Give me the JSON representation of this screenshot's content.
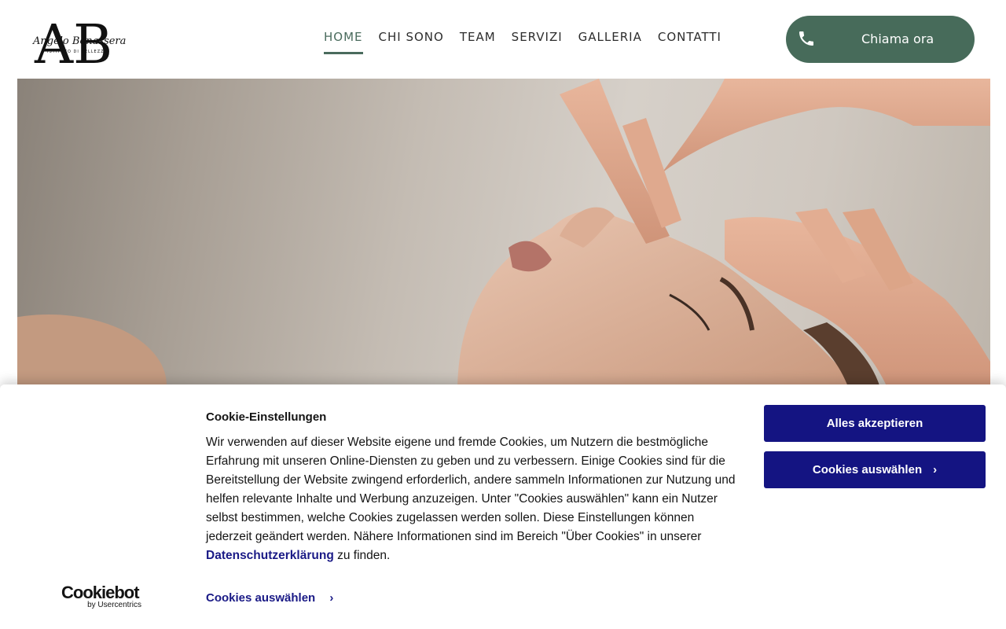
{
  "header": {
    "logo_text": "Angelo Bonassera",
    "logo_subtext": "ISTITUTO DI BELLEZZA",
    "logo_initials": "AB",
    "nav": [
      {
        "label": "HOME",
        "active": true
      },
      {
        "label": "CHI SONO",
        "active": false
      },
      {
        "label": "TEAM",
        "active": false
      },
      {
        "label": "SERVIZI",
        "active": false
      },
      {
        "label": "GALLERIA",
        "active": false
      },
      {
        "label": "CONTATTI",
        "active": false
      }
    ],
    "call_button": {
      "label": "Chiama ora",
      "icon": "phone-icon"
    }
  },
  "hero": {
    "image": "facial-massage-photo"
  },
  "cookie_banner": {
    "title": "Cookie-Einstellungen",
    "text_before_link": "Wir verwenden auf dieser Website eigene und fremde Cookies, um Nutzern die bestmögliche Erfahrung mit unseren Online-Diensten zu geben und zu verbessern. Einige Cookies sind für die Bereitstellung der Website zwingend erforderlich, andere sammeln Informationen zur Nutzung und helfen relevante Inhalte und Werbung anzuzeigen. Unter \"Cookies auswählen\" kann ein Nutzer selbst bestimmen, welche Cookies zugelassen werden sollen. Diese Einstellungen können jederzeit geändert werden. Nähere Informationen sind im Bereich \"Über Cookies\" in unserer ",
    "link_text": "Datenschutzerklärung",
    "text_after_link": " zu finden.",
    "accept_all_label": "Alles akzeptieren",
    "select_cookies_label": "Cookies auswählen",
    "select_cookies_link_label": "Cookies auswählen",
    "chevron": "›",
    "brand": "Cookiebot",
    "brand_sub": "by Usercentrics"
  },
  "colors": {
    "accent_green": "#476b5a",
    "banner_button_navy": "#141482",
    "link_navy": "#1a1a86"
  }
}
